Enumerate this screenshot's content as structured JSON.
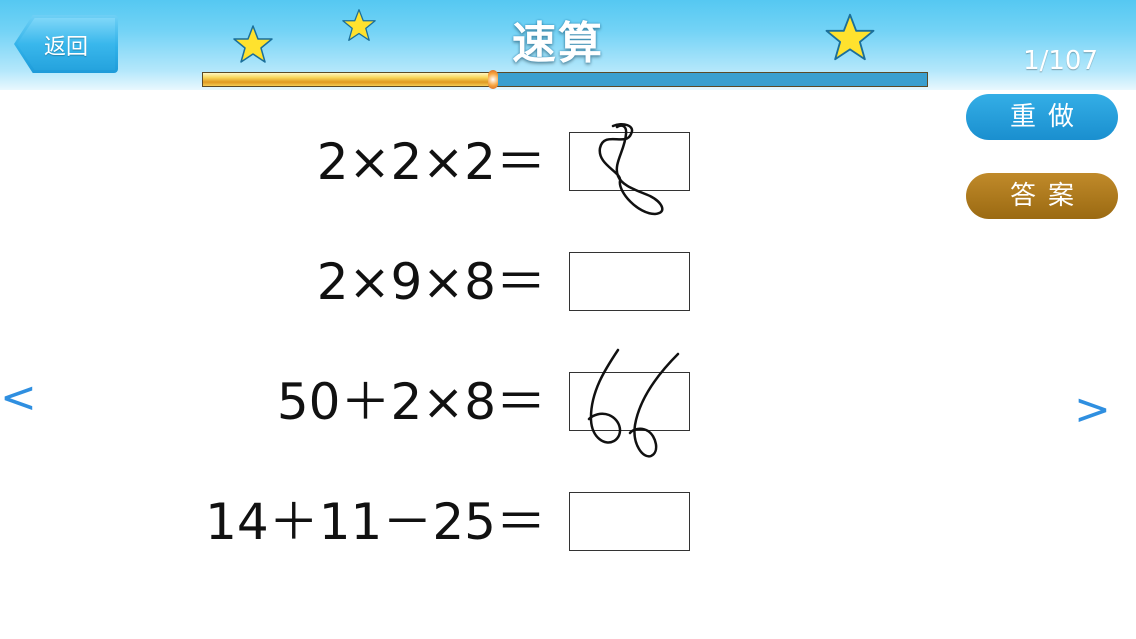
{
  "header": {
    "back_label": "返回",
    "title": "速算",
    "counter": "1/107",
    "progress_fraction": 0.4
  },
  "buttons": {
    "redo_label": "重做",
    "answer_label": "答案"
  },
  "problems": [
    {
      "expression": "2×2×2＝",
      "handwritten_answer": "8"
    },
    {
      "expression": "2×9×8＝",
      "handwritten_answer": ""
    },
    {
      "expression": "50＋2×8＝",
      "handwritten_answer": "66"
    },
    {
      "expression": "14＋11－25＝",
      "handwritten_answer": ""
    }
  ],
  "nav": {
    "prev": "<",
    "next": ">"
  },
  "colors": {
    "header_blue": "#55c8f2",
    "redo_button": "#1e94d2",
    "answer_button": "#a87416",
    "nav_arrow": "#2f8fe0",
    "star_yellow": "#ffe22e"
  },
  "icons": [
    "star-icon",
    "star-icon",
    "star-icon",
    "back-arrow-icon",
    "chevron-left-icon",
    "chevron-right-icon"
  ]
}
